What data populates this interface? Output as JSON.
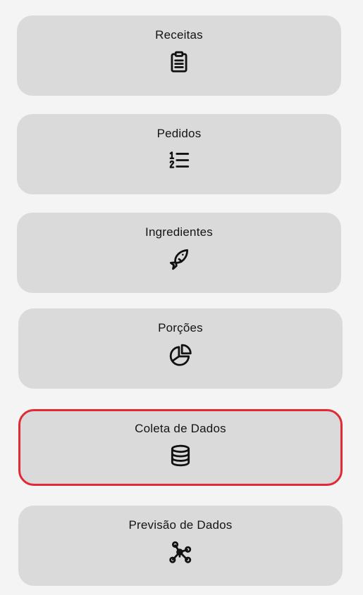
{
  "menu": {
    "items": [
      {
        "label": "Receitas",
        "icon": "clipboard-icon"
      },
      {
        "label": "Pedidos",
        "icon": "numbered-list-icon"
      },
      {
        "label": "Ingredientes",
        "icon": "fish-icon"
      },
      {
        "label": "Porções",
        "icon": "pie-chart-icon"
      },
      {
        "label": "Coleta de Dados",
        "icon": "database-icon",
        "selected": true
      },
      {
        "label": "Previsão de Dados",
        "icon": "network-graph-icon"
      }
    ]
  },
  "colors": {
    "background": "#f4f4f4",
    "card": "#dadada",
    "selected_border": "#e02a35",
    "text": "#141414"
  }
}
